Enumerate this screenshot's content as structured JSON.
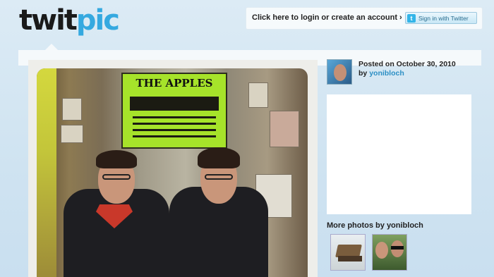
{
  "header": {
    "logo_part_a": "twit",
    "logo_part_b": "pic",
    "login_link": "Click here to login or create an account ›",
    "twitter_button": "Sign in with Twitter"
  },
  "photo": {
    "poster_title": "THE APPLES"
  },
  "post": {
    "posted_on": "Posted on October 30, 2010",
    "by_label": "by",
    "author": "yonibloch"
  },
  "sidebar": {
    "more_photos_heading": "More photos by yonibloch"
  },
  "colors": {
    "brand_blue": "#35a9e0",
    "link_blue": "#2c8fc4",
    "background": "#d4e6f3"
  },
  "icons": {
    "twitter_icon_glyph": "t"
  }
}
